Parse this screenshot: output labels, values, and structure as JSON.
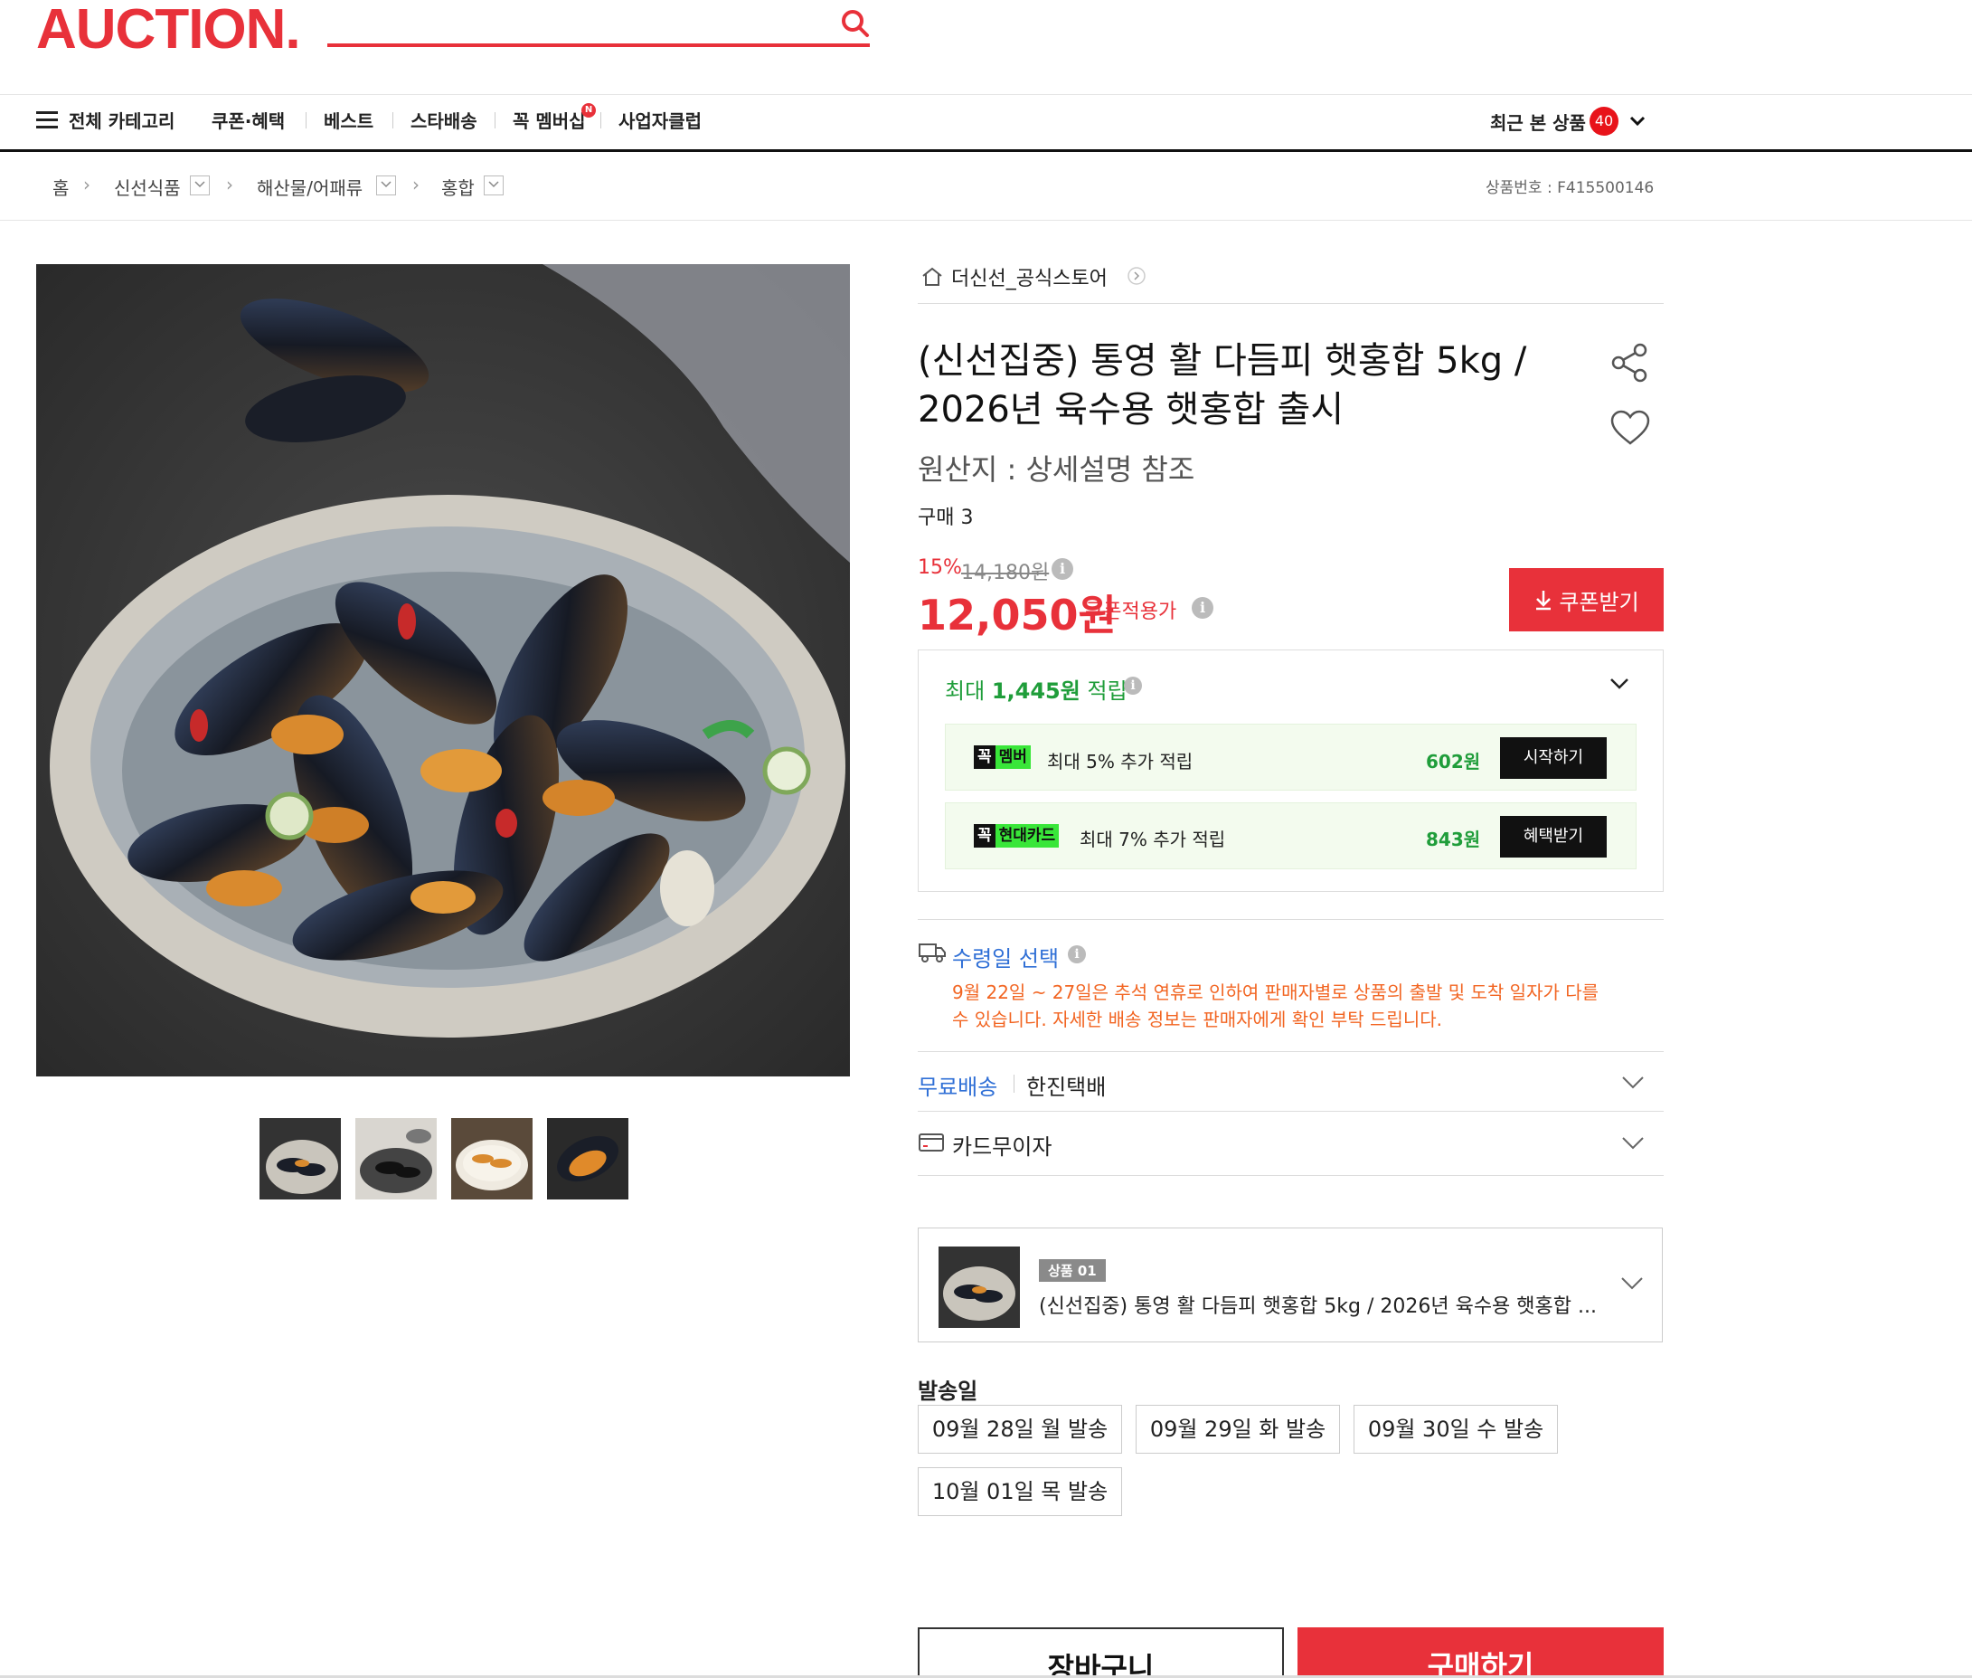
{
  "header": {
    "logo": "AUCTION.",
    "search_placeholder": ""
  },
  "nav": {
    "all_categories": "전체 카테고리",
    "items": [
      "쿠폰·혜택",
      "베스트",
      "스타배송",
      "꼭 멤버십",
      "사업자클럽"
    ],
    "new_badge": "N",
    "recent": "최근 본 상품",
    "recent_count": "40"
  },
  "breadcrumb": {
    "home": "홈",
    "items": [
      "신선식품",
      "해산물/어패류",
      "홍합"
    ],
    "product_no": "상품번호 : F415500146"
  },
  "product": {
    "store": "더신선_공식스토어",
    "title": "(신선집중) 통영 활 다듬피 햇홍합 5kg / 2026년 육수용 햇홍합 출시",
    "origin": "원산지 : 상세설명 참조",
    "buy_count": "구매 3",
    "discount_rate": "15%",
    "original_price": "14,180원",
    "price": "12,050원",
    "coupon_price_label": "쿠폰적용가",
    "coupon_button": "쿠폰받기"
  },
  "reward": {
    "prefix": "최대",
    "amount": "1,445원",
    "suffix": "적립",
    "rows": [
      {
        "badge_a": "꼭",
        "badge_b": "멤버",
        "text": "최대 5% 추가 적립",
        "amount": "602원",
        "button": "시작하기"
      },
      {
        "badge_a": "꼭",
        "badge_b": "현대카드",
        "text": "최대 7% 추가 적립",
        "amount": "843원",
        "button": "혜택받기"
      }
    ]
  },
  "delivery": {
    "receive_title": "수령일 선택",
    "notice": "9월 22일 ~ 27일은 추석 연휴로 인하여 판매자별로 상품의 출발 및 도착 일자가 다를 수 있습니다. 자세한 배송 정보는 판매자에게 확인 부탁 드립니다.",
    "free_shipping": "무료배송",
    "courier": "한진택배",
    "card_installment": "카드무이자"
  },
  "option": {
    "badge": "상품 01",
    "name": "(신선집중) 통영 활 다듬피 햇홍합 5kg / 2026년 육수용 햇홍합 ..."
  },
  "send_dates": {
    "title": "발송일",
    "dates": [
      "09월 28일 월 발송",
      "09월 29일 화 발송",
      "09월 30일 수 발송",
      "10월 01일 목 발송"
    ]
  },
  "actions": {
    "cart": "장바구니",
    "buy": "구매하기"
  },
  "colors": {
    "brand": "#e8313a",
    "reward_green": "#1f9d3a",
    "link_blue": "#2f6fd6",
    "notice_orange": "#f26522"
  }
}
